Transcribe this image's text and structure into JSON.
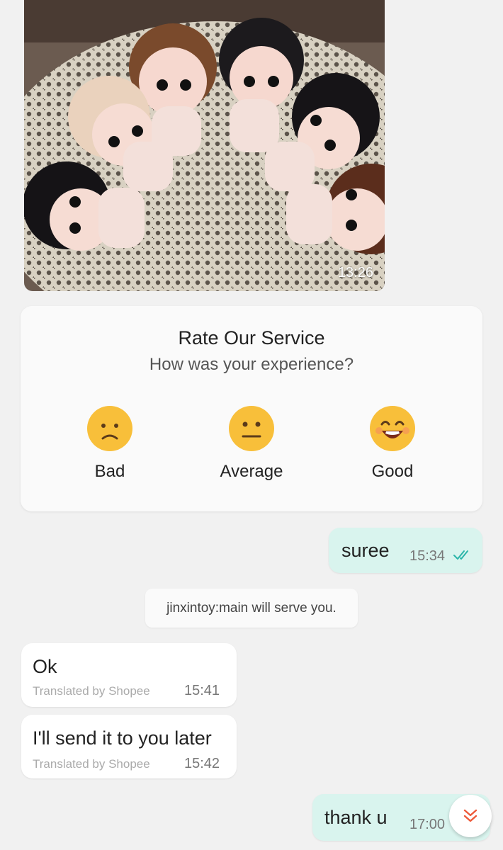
{
  "photo_message": {
    "time": "13:26",
    "image_icon": "plush-dolls-photo"
  },
  "rating": {
    "title": "Rate Our Service",
    "subtitle": "How was your experience?",
    "options": [
      {
        "label": "Bad",
        "icon": "sad-face-icon"
      },
      {
        "label": "Average",
        "icon": "neutral-face-icon"
      },
      {
        "label": "Good",
        "icon": "happy-face-icon"
      }
    ],
    "emoji_color": "#f8bf3a"
  },
  "messages": [
    {
      "direction": "out",
      "text": "suree",
      "time": "15:34",
      "status": "read"
    },
    {
      "direction": "system",
      "text": "jinxintoy:main will serve you."
    },
    {
      "direction": "in",
      "text": "Ok",
      "translated": "Translated by Shopee",
      "time": "15:41"
    },
    {
      "direction": "in",
      "text": "I'll send it to you later",
      "translated": "Translated by Shopee",
      "time": "15:42"
    },
    {
      "direction": "out",
      "text": "thank u",
      "time": "17:00"
    }
  ],
  "colors": {
    "outgoing_bubble": "#d9f4ee",
    "read_check": "#2bb5a9",
    "scroll_arrow": "#ee5a3a"
  },
  "scroll_button": {
    "icon": "double-chevron-down-icon"
  }
}
